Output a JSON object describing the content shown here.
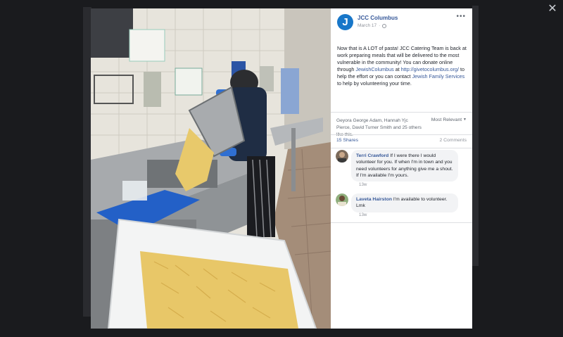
{
  "post": {
    "page_name": "JCC Columbus",
    "avatar_letter": "J",
    "date": "March 17",
    "text_1": "Now that is A LOT of pasta! JCC Catering Team is back at work preparing meals that will be delivered to the most vulnerable in the community! You can donate online through ",
    "link_1": "JewishColumbus",
    "text_2": " at ",
    "link_2": "http://givetocolumbus.org/",
    "text_3": " to help the effort or you can contact ",
    "link_3": "Jewish Family Services",
    "text_4": " to help by volunteering your time."
  },
  "reactions": {
    "likes_text": "Geyora George Adam, Hannah Yjc Pierce, David Turner Smith and 25 others like this.",
    "sort_label": "Most Relevant",
    "shares_label": "15 Shares",
    "comments_label": "2 Comments"
  },
  "comments": [
    {
      "author": "Terri Crawford",
      "text": "If I were there I would volunteer for you. If when I'm in town and you need volunteers for anything give me a shout. If I'm available I'm yours.",
      "time": "13w"
    },
    {
      "author": "Laveta Hairston",
      "text": "I'm available to volunteer. Lmk",
      "time": "13w"
    }
  ],
  "colors": {
    "link": "#365899",
    "brand": "#1877c9",
    "backdrop": "#111214"
  },
  "icons": [
    "close-icon",
    "more-options-icon",
    "globe-icon",
    "caret-down-icon"
  ]
}
